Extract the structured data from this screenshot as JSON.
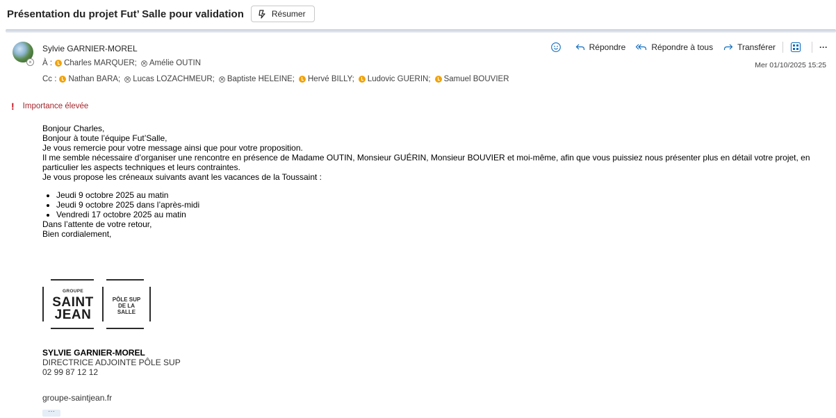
{
  "header": {
    "subject": "Présentation du projet Fut’ Salle pour validation",
    "summarize_label": "Résumer"
  },
  "message": {
    "sender": "Sylvie GARNIER-MOREL",
    "to_label": "À :",
    "to": [
      "Charles MARQUER;",
      "Amélie OUTIN"
    ],
    "cc_label": "Cc :",
    "cc": [
      "Nathan BARA;",
      "Lucas LOZACHMEUR;",
      "Baptiste HELEINE;",
      "Hervé BILLY;",
      "Ludovic GUERIN;",
      "Samuel BOUVIER"
    ],
    "date": "Mer 01/10/2025 15:25",
    "importance_icon": "!",
    "importance": "Importance élevée"
  },
  "actions": {
    "reply": "Répondre",
    "reply_all": "Répondre à tous",
    "forward": "Transférer",
    "more": "···"
  },
  "body": {
    "lines": [
      "Bonjour Charles,",
      "Bonjour à toute l’équipe Fut’Salle,",
      "Je vous remercie pour votre message ainsi que pour votre proposition.",
      "Il me semble nécessaire d’organiser une rencontre en présence de Madame OUTIN, Monsieur GUÉRIN, Monsieur BOUVIER et moi-même, afin que vous puissiez nous présenter plus en détail votre projet, en particulier les aspects techniques et leurs contraintes.",
      "Je vous propose les créneaux suivants avant les vacances de la Toussaint :"
    ],
    "slots": [
      "Jeudi 9 octobre 2025 au matin",
      "Jeudi 9 octobre 2025 dans l’après-midi",
      "Vendredi 17 octobre 2025 au matin"
    ],
    "closing": [
      "Dans l’attente de votre retour,",
      "Bien cordialement,"
    ]
  },
  "logo": {
    "groupe": "GROUPE",
    "saint": "SAINT",
    "jean": "JEAN",
    "pole_1": "PÔLE SUP",
    "pole_2": "DE LA",
    "pole_3": "SALLE"
  },
  "signature": {
    "name": "SYLVIE GARNIER-MOREL",
    "title": "DIRECTRICE ADJOINTE PÔLE SUP",
    "phone": "02 99 87 12 12",
    "site": "groupe-saintjean.fr",
    "more": "···"
  }
}
